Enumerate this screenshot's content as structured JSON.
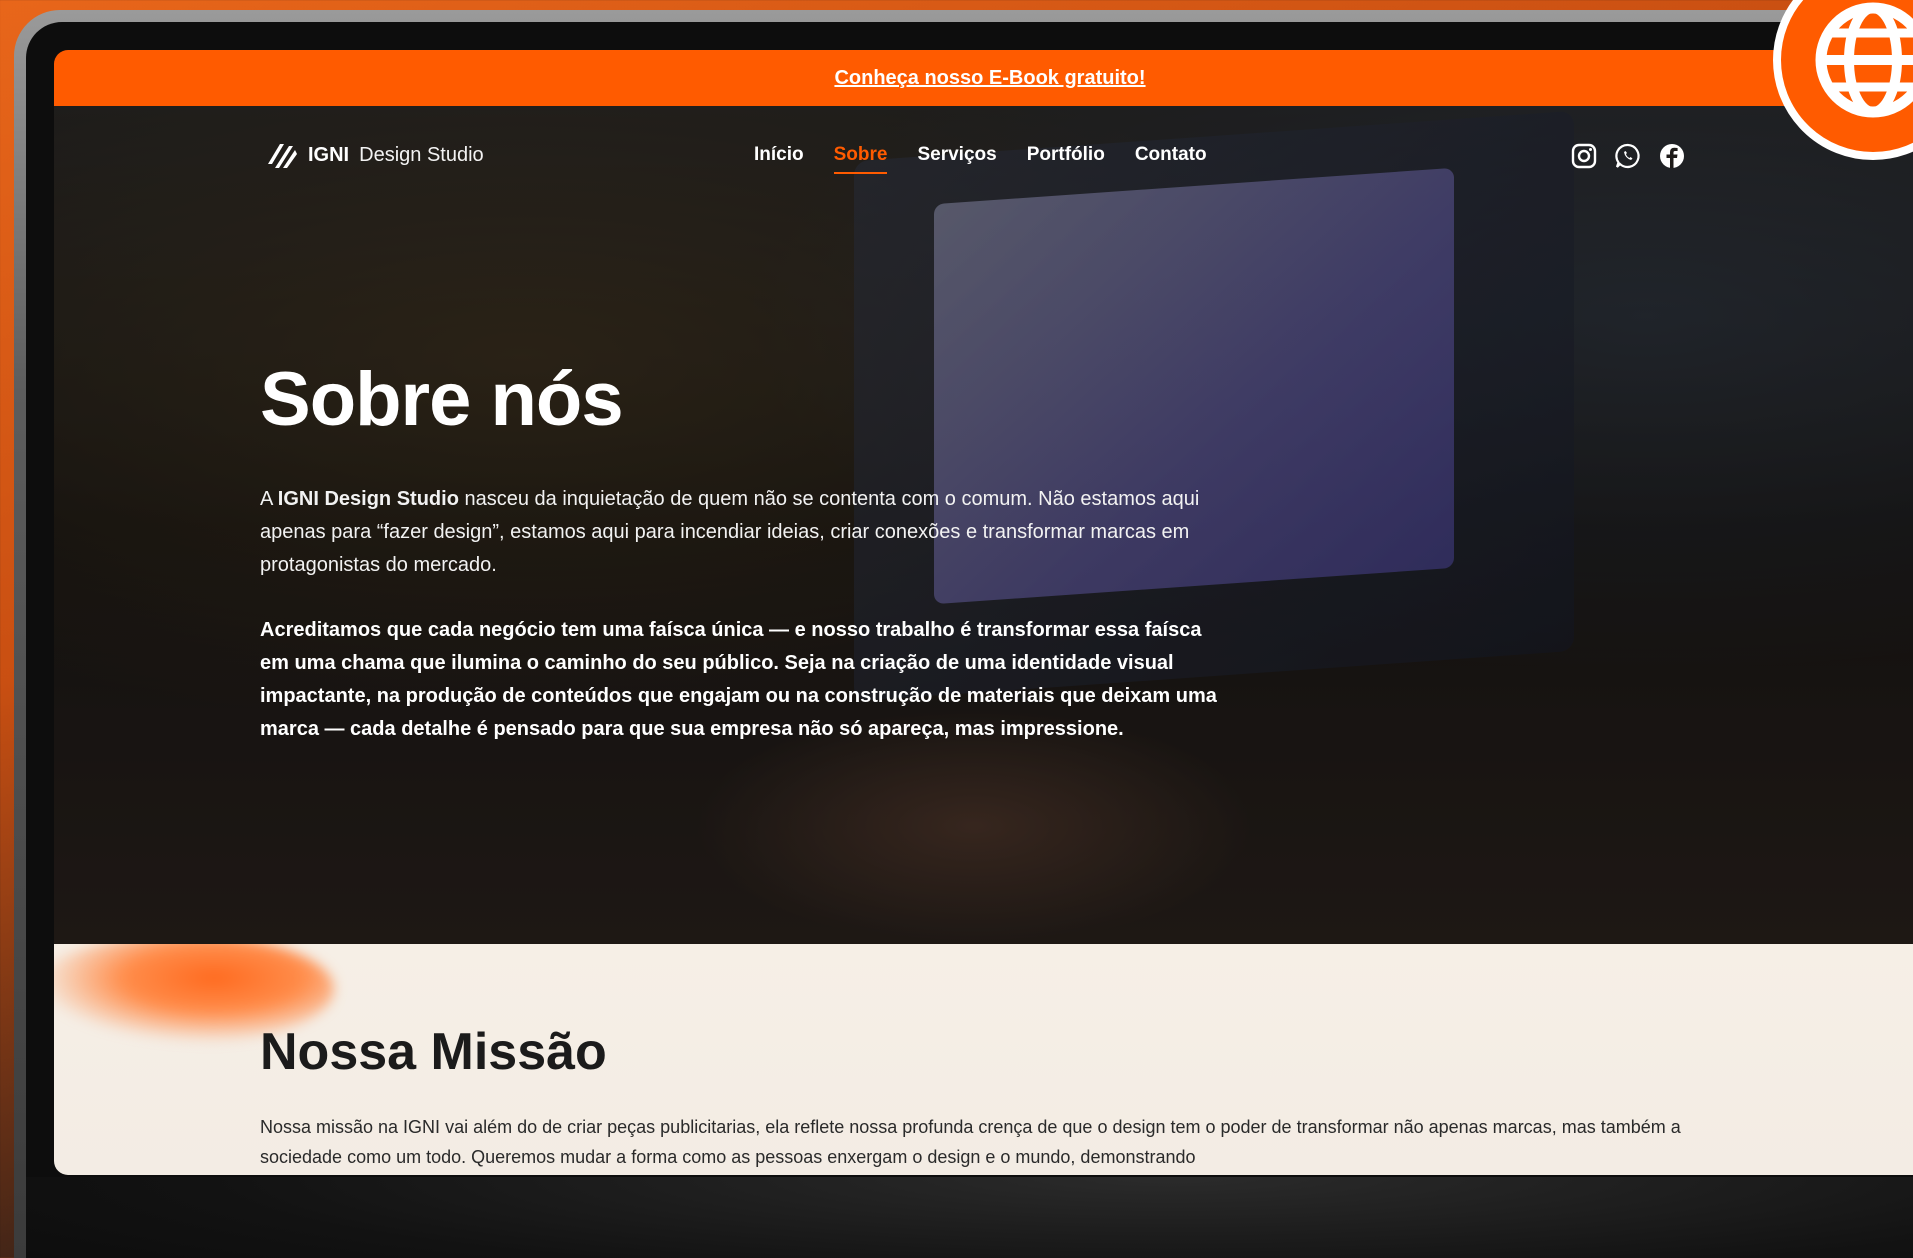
{
  "announcement": {
    "link_text": "Conheça nosso E-Book gratuito!"
  },
  "brand": {
    "name": "IGNI",
    "subtitle": "Design Studio"
  },
  "nav": {
    "items": [
      {
        "label": "Início",
        "active": false
      },
      {
        "label": "Sobre",
        "active": true
      },
      {
        "label": "Serviços",
        "active": false
      },
      {
        "label": "Portfólio",
        "active": false
      },
      {
        "label": "Contato",
        "active": false
      }
    ]
  },
  "socials": [
    "instagram-icon",
    "whatsapp-icon",
    "facebook-icon"
  ],
  "hero": {
    "title": "Sobre nós",
    "p1_prefix": "A ",
    "p1_bold": "IGNI Design Studio",
    "p1_rest": " nasceu da inquietação de quem não se contenta com o comum. Não estamos aqui apenas para “fazer design”, estamos aqui para incendiar ideias, criar conexões e transformar marcas em protagonistas do mercado.",
    "p2": "Acreditamos que cada negócio tem uma faísca única — e nosso trabalho é transformar essa faísca em uma chama que ilumina o caminho do seu público. Seja na criação de uma identidade visual impactante, na produção de conteúdos que engajam ou na construção de materiais que deixam uma marca — cada detalhe é pensado para que sua empresa não só apareça, mas impressione."
  },
  "mission": {
    "title": "Nossa Missão",
    "text": "Nossa missão na IGNI vai além do de criar peças publicitarias, ela reflete nossa profunda crença de que o design tem o poder de transformar não apenas marcas, mas também a sociedade como um todo. Queremos mudar a forma como as pessoas enxergam o design e o mundo, demonstrando"
  },
  "colors": {
    "accent": "#ff5b00",
    "mission_bg": "#f6efe6",
    "badge": "#ff5b00"
  },
  "badge_icon": "globe-icon"
}
